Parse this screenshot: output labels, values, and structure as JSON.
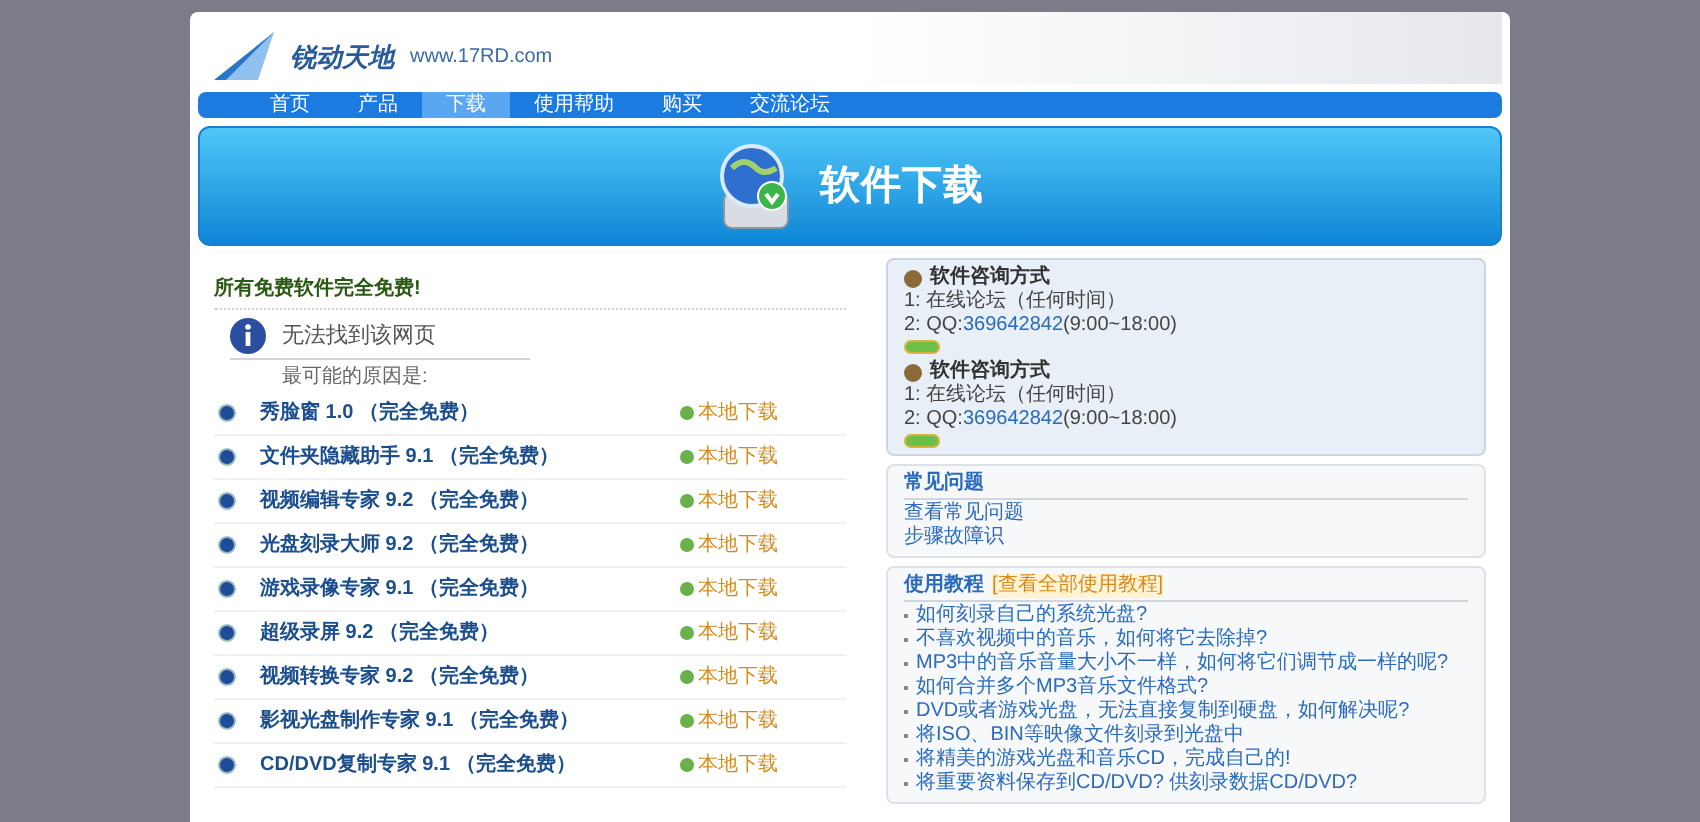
{
  "logo": {
    "name": "锐动天地",
    "url": "www.17RD.com"
  },
  "nav": [
    {
      "label": "首页",
      "selected": false
    },
    {
      "label": "产品",
      "selected": false
    },
    {
      "label": "下载",
      "selected": true
    },
    {
      "label": "使用帮助",
      "selected": false
    },
    {
      "label": "购买",
      "selected": false
    },
    {
      "label": "交流论坛",
      "selected": false
    }
  ],
  "banner": {
    "title": "软件下载"
  },
  "main": {
    "heading": "所有免费软件完全免费!",
    "error_box": {
      "title": "无法找到该网页",
      "subtitle": "最可能的原因是:"
    },
    "downloads": [
      {
        "name": "秀脸窗 1.0 （完全免费）",
        "action": "本地下载"
      },
      {
        "name": "文件夹隐藏助手 9.1 （完全免费）",
        "action": "本地下载"
      },
      {
        "name": "视频编辑专家 9.2 （完全免费）",
        "action": "本地下载"
      },
      {
        "name": "光盘刻录大师 9.2 （完全免费）",
        "action": "本地下载"
      },
      {
        "name": "游戏录像专家 9.1 （完全免费）",
        "action": "本地下载"
      },
      {
        "name": "超级录屏 9.2 （完全免费）",
        "action": "本地下载"
      },
      {
        "name": "视频转换专家 9.2 （完全免费）",
        "action": "本地下载"
      },
      {
        "name": "影视光盘制作专家 9.1 （完全免费）",
        "action": "本地下载"
      },
      {
        "name": "CD/DVD复制专家 9.1 （完全免费）",
        "action": "本地下载"
      }
    ]
  },
  "sidebar": {
    "contacts": [
      {
        "title": "软件咨询方式",
        "line_1": "1: 在线论坛（任何时间）",
        "line_2_prefix": "2: QQ:",
        "qq": "369642842",
        "hours": "(9:00~18:00)"
      },
      {
        "title": "软件咨询方式",
        "line_1": "1: 在线论坛（任何时间）",
        "line_2_prefix": "2: QQ:",
        "qq": "369642842",
        "hours": "(9:00~18:00)"
      }
    ],
    "faq": {
      "title": "常见问题",
      "links": [
        "查看常见问题",
        "步骤故障识"
      ]
    },
    "tutorials": {
      "title": "使用教程",
      "all_link": "[查看全部使用教程]",
      "items": [
        "如何刻录自己的系统光盘?",
        "不喜欢视频中的音乐，如何将它去除掉?",
        "MP3中的音乐音量大小不一样，如何将它们调节成一样的呢?",
        "如何合并多个MP3音乐文件格式?",
        "DVD或者游戏光盘，无法直接复制到硬盘，如何解决呢?",
        "将ISO、BIN等映像文件刻录到光盘中",
        "将精美的游戏光盘和音乐CD，完成自己的!",
        "将重要资料保存到CD/DVD? 供刻录数据CD/DVD?"
      ]
    }
  }
}
